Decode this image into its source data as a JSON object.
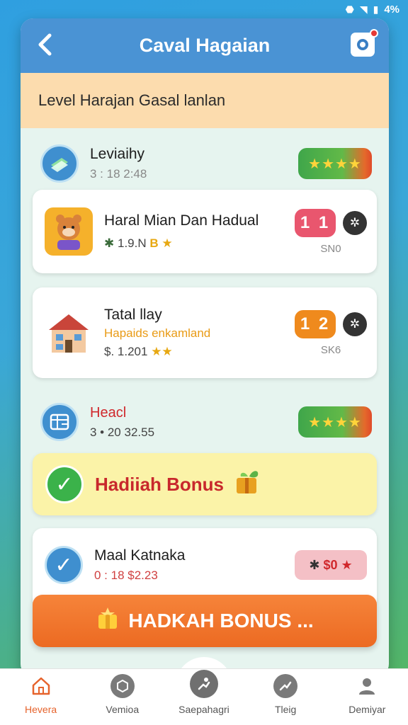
{
  "status_bar": {
    "battery": "4%"
  },
  "header": {
    "title": "Caval Hagaian"
  },
  "subheader": {
    "text": "Level Harajan  Gasal lanlan"
  },
  "rows": [
    {
      "title": "Leviaihy",
      "subtitle": "3 : 18 2:48"
    },
    {
      "title": "Haral Mian Dan Hadual",
      "subtitle": "1.9.N",
      "badge": "B",
      "count": "1 1",
      "code": "SN0"
    },
    {
      "title": "Tatal llay",
      "tagline": "Hapaids enkamland",
      "subtitle": "$. 1.201",
      "count": "1 2",
      "code": "SK6"
    },
    {
      "title": "Heacl",
      "subtitle": "3 • 20 32.55"
    },
    {
      "title": "Maal Katnaka",
      "subtitle": "0 : 18 $2.23",
      "pill": "$0"
    }
  ],
  "bonus_banner": {
    "text": "Hadiiah Bonus"
  },
  "cta": {
    "label": "HADKAH BONUS ..."
  },
  "bottom_nav": [
    {
      "label": "Hevera",
      "icon": "home-icon"
    },
    {
      "label": "Vemioa",
      "icon": "box-icon"
    },
    {
      "label": "Saepahagri",
      "icon": "activity-icon"
    },
    {
      "label": "Tleig",
      "icon": "chart-icon"
    },
    {
      "label": "Demiyar",
      "icon": "profile-icon"
    }
  ],
  "colors": {
    "header": "#4a93d4",
    "subheader": "#fcdcae",
    "cta": "#ec6a22",
    "bonus_banner": "#fbf3a8",
    "accent_active": "#e6632c"
  }
}
